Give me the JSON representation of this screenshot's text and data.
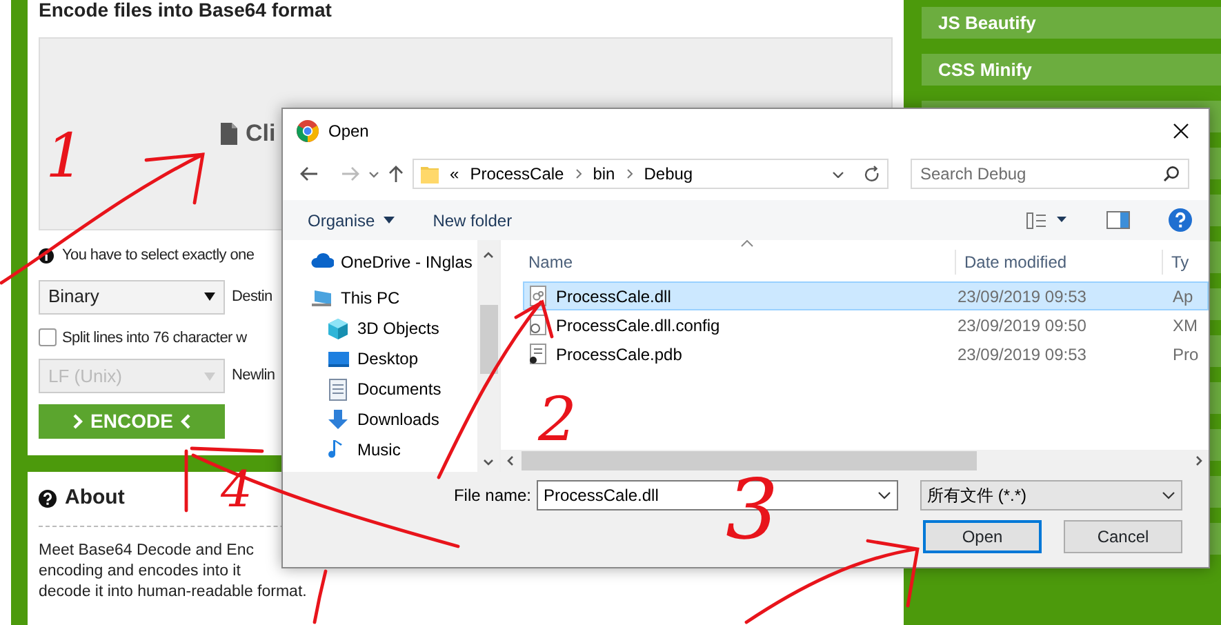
{
  "page": {
    "title": "Encode files into Base64 format",
    "dropzone_label": "Cli",
    "info": "You have to select exactly one",
    "charset_select": "Binary",
    "destination_label": "Destin",
    "split_lines": {
      "label": "Split lines into 76 character w",
      "checked": false
    },
    "newline_select": {
      "value": "LF (Unix)",
      "disabled": true
    },
    "newline_label": "Newlin",
    "encode_button": "ENCODE"
  },
  "about": {
    "title": "About",
    "lines": [
      "Meet Base64 Decode and Enc",
      "encoding and encodes into it",
      "decode it into human-readable format."
    ]
  },
  "sidebar": {
    "items": [
      "JS Beautify",
      "CSS Minify"
    ]
  },
  "dialog": {
    "title": "Open",
    "path_overflow": "«",
    "path": [
      "ProcessCale",
      "bin",
      "Debug"
    ],
    "search_placeholder": "Search Debug",
    "toolbar": {
      "organise": "Organise",
      "new_folder": "New folder"
    },
    "nav": [
      {
        "label": "OneDrive - INglas",
        "kind": "cloud"
      },
      {
        "label": "This PC",
        "kind": "pc",
        "children": [
          {
            "label": "3D Objects",
            "kind": "objects"
          },
          {
            "label": "Desktop",
            "kind": "desktop"
          },
          {
            "label": "Documents",
            "kind": "documents"
          },
          {
            "label": "Downloads",
            "kind": "downloads"
          },
          {
            "label": "Music",
            "kind": "music"
          }
        ]
      }
    ],
    "columns": [
      "Name",
      "Date modified",
      "Ty"
    ],
    "files": [
      {
        "name": "ProcessCale.dll",
        "date": "23/09/2019 09:53",
        "type": "Ap",
        "kind": "dll",
        "selected": true
      },
      {
        "name": "ProcessCale.dll.config",
        "date": "23/09/2019 09:50",
        "type": "XM",
        "kind": "config",
        "selected": false
      },
      {
        "name": "ProcessCale.pdb",
        "date": "23/09/2019 09:53",
        "type": "Pro",
        "kind": "pdb",
        "selected": false
      }
    ],
    "file_name_label": "File name:",
    "file_name": "ProcessCale.dll",
    "file_type": "所有文件 (*.*)",
    "buttons": [
      {
        "label": "Open",
        "default": true
      },
      {
        "label": "Cancel",
        "default": false
      }
    ]
  },
  "annotations": [
    {
      "label": "1"
    },
    {
      "label": "2"
    },
    {
      "label": "3"
    },
    {
      "label": "4"
    }
  ]
}
